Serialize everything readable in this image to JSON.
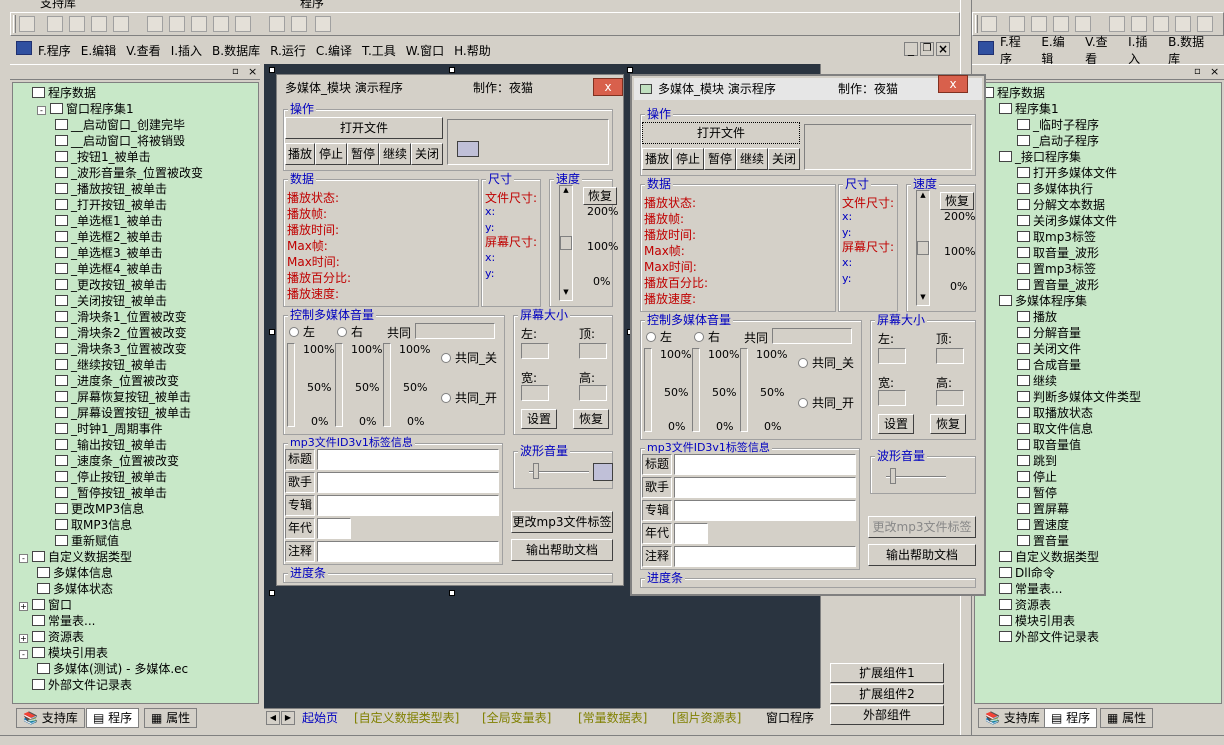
{
  "top_partial_labels": [
    "支持库",
    "程序"
  ],
  "menu": [
    "F.程序",
    "E.编辑",
    "V.查看",
    "I.插入",
    "B.数据库",
    "R.运行",
    "C.编译",
    "T.工具",
    "W.窗口",
    "H.帮助"
  ],
  "menu_right": [
    "F.程序",
    "E.编辑",
    "V.查看",
    "I.插入",
    "B.数据库"
  ],
  "left_tree": [
    {
      "t": "程序数据",
      "l": 0,
      "ex": ""
    },
    {
      "t": "窗口程序集1",
      "l": 1,
      "ex": "-"
    },
    {
      "t": "__启动窗口_创建完毕",
      "l": 2
    },
    {
      "t": "__启动窗口_将被销毁",
      "l": 2
    },
    {
      "t": "_按钮1_被单击",
      "l": 2
    },
    {
      "t": "_波形音量条_位置被改变",
      "l": 2
    },
    {
      "t": "_播放按钮_被单击",
      "l": 2
    },
    {
      "t": "_打开按钮_被单击",
      "l": 2
    },
    {
      "t": "_单选框1_被单击",
      "l": 2
    },
    {
      "t": "_单选框2_被单击",
      "l": 2
    },
    {
      "t": "_单选框3_被单击",
      "l": 2
    },
    {
      "t": "_单选框4_被单击",
      "l": 2
    },
    {
      "t": "_更改按钮_被单击",
      "l": 2
    },
    {
      "t": "_关闭按钮_被单击",
      "l": 2
    },
    {
      "t": "_滑块条1_位置被改变",
      "l": 2
    },
    {
      "t": "_滑块条2_位置被改变",
      "l": 2
    },
    {
      "t": "_滑块条3_位置被改变",
      "l": 2
    },
    {
      "t": "_继续按钮_被单击",
      "l": 2
    },
    {
      "t": "_进度条_位置被改变",
      "l": 2
    },
    {
      "t": "_屏幕恢复按钮_被单击",
      "l": 2
    },
    {
      "t": "_屏幕设置按钮_被单击",
      "l": 2
    },
    {
      "t": "_时钟1_周期事件",
      "l": 2
    },
    {
      "t": "_输出按钮_被单击",
      "l": 2
    },
    {
      "t": "_速度条_位置被改变",
      "l": 2
    },
    {
      "t": "_停止按钮_被单击",
      "l": 2
    },
    {
      "t": "_暂停按钮_被单击",
      "l": 2
    },
    {
      "t": "更改MP3信息",
      "l": 2
    },
    {
      "t": "取MP3信息",
      "l": 2
    },
    {
      "t": "重新赋值",
      "l": 2
    },
    {
      "t": "自定义数据类型",
      "l": 0,
      "ex": "-"
    },
    {
      "t": "多媒体信息",
      "l": 1
    },
    {
      "t": "多媒体状态",
      "l": 1
    },
    {
      "t": "窗口",
      "l": 0,
      "ex": "+"
    },
    {
      "t": "常量表...",
      "l": 0,
      "ex": ""
    },
    {
      "t": "资源表",
      "l": 0,
      "ex": "+"
    },
    {
      "t": "模块引用表",
      "l": 0,
      "ex": "-"
    },
    {
      "t": "多媒体(测试) - 多媒体.ec",
      "l": 1
    },
    {
      "t": "外部文件记录表",
      "l": 0,
      "ex": ""
    }
  ],
  "right_tree": [
    {
      "t": "程序数据",
      "l": 0
    },
    {
      "t": "程序集1",
      "l": 1
    },
    {
      "t": "_临时子程序",
      "l": 2
    },
    {
      "t": "_启动子程序",
      "l": 2
    },
    {
      "t": "_接口程序集",
      "l": 1
    },
    {
      "t": "打开多媒体文件",
      "l": 2
    },
    {
      "t": "多媒体执行",
      "l": 2
    },
    {
      "t": "分解文本数据",
      "l": 2
    },
    {
      "t": "关闭多媒体文件",
      "l": 2
    },
    {
      "t": "取mp3标签",
      "l": 2
    },
    {
      "t": "取音量_波形",
      "l": 2
    },
    {
      "t": "置mp3标签",
      "l": 2
    },
    {
      "t": "置音量_波形",
      "l": 2
    },
    {
      "t": "多媒体程序集",
      "l": 1
    },
    {
      "t": "播放",
      "l": 2
    },
    {
      "t": "分解音量",
      "l": 2
    },
    {
      "t": "关闭文件",
      "l": 2
    },
    {
      "t": "合成音量",
      "l": 2
    },
    {
      "t": "继续",
      "l": 2
    },
    {
      "t": "判断多媒体文件类型",
      "l": 2
    },
    {
      "t": "取播放状态",
      "l": 2
    },
    {
      "t": "取文件信息",
      "l": 2
    },
    {
      "t": "取音量值",
      "l": 2
    },
    {
      "t": "跳到",
      "l": 2
    },
    {
      "t": "停止",
      "l": 2
    },
    {
      "t": "暂停",
      "l": 2
    },
    {
      "t": "置屏幕",
      "l": 2
    },
    {
      "t": "置速度",
      "l": 2
    },
    {
      "t": "置音量",
      "l": 2
    },
    {
      "t": "自定义数据类型",
      "l": 1
    },
    {
      "t": "Dll命令",
      "l": 1
    },
    {
      "t": "常量表...",
      "l": 1
    },
    {
      "t": "资源表",
      "l": 1
    },
    {
      "t": "模块引用表",
      "l": 1
    },
    {
      "t": "外部文件记录表",
      "l": 1
    }
  ],
  "panel_tabs": [
    "支持库",
    "程序",
    "属性"
  ],
  "designer": {
    "title": "多媒体_模块  演示程序",
    "author": "制作：夜猫",
    "close": "x",
    "grp_op": "操作",
    "open_btn": "打开文件",
    "ctrl_btns": [
      "播放",
      "停止",
      "暂停",
      "继续",
      "关闭"
    ],
    "grp_data": "数据",
    "data_labels": [
      "播放状态:",
      "播放帧:",
      "播放时间:",
      "Max帧:",
      "Max时间:",
      "播放百分比:",
      "播放速度:"
    ],
    "grp_size": "尺寸",
    "file_size": "文件尺寸:",
    "screen_size": "屏幕尺寸:",
    "x": "x:",
    "y": "y:",
    "grp_speed": "速度",
    "restore": "恢复",
    "pct200": "200%",
    "pct100": "100%",
    "pct0": "0%",
    "pct50": "50%",
    "grp_vol": "控制多媒体音量",
    "left": "左",
    "right": "右",
    "common": "共同",
    "common_off": "共同_关",
    "common_on": "共同_开",
    "grp_screen": "屏幕大小",
    "s_left": "左:",
    "s_top": "顶:",
    "s_width": "宽:",
    "s_height": "高:",
    "set": "设置",
    "s_restore": "恢复",
    "grp_mp3": "mp3文件ID3v1标签信息",
    "mp3_fields": [
      "标题",
      "歌手",
      "专辑",
      "年代",
      "注释"
    ],
    "grp_wave": "波形音量",
    "change_btn": "更改mp3文件标签",
    "output_btn": "输出帮助文档",
    "progress": "进度条"
  },
  "doc_tabs": [
    "起始页",
    "[自定义数据类型表]",
    "[全局变量表]",
    "[常量数据表]",
    "[图片资源表]",
    "窗口程序"
  ],
  "ext_buttons": [
    "扩展组件1",
    "扩展组件2",
    "外部组件"
  ]
}
